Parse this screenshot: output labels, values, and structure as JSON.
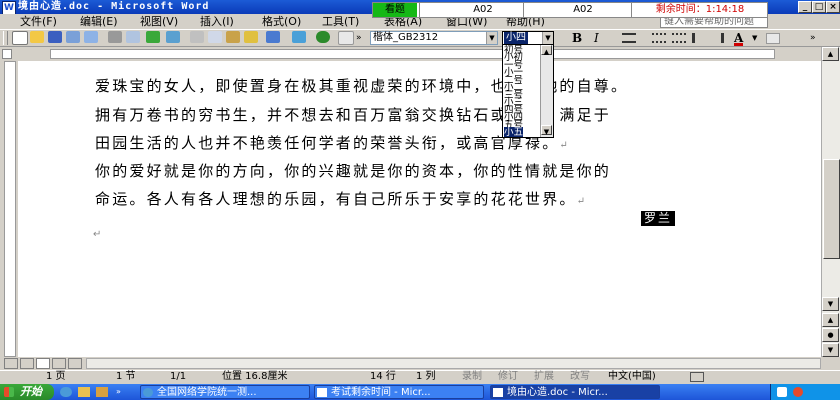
{
  "window": {
    "title": "境由心造.doc - Microsoft Word",
    "minimize_glyph": "_",
    "maximize_glyph": "□",
    "close_glyph": "×"
  },
  "exam_bar": {
    "status_label": "看题",
    "question_1": "A02",
    "question_2": "A02",
    "timer_label": "剩余时间：1:14:18"
  },
  "menu": {
    "items": [
      "文件(F)",
      "编辑(E)",
      "视图(V)",
      "插入(I)",
      "格式(O)",
      "工具(T)",
      "表格(A)",
      "窗口(W)",
      "帮助(H)"
    ],
    "help_box_text": "键入需要帮助的问题"
  },
  "formatting_toolbar": {
    "font_name": "楷体_GB2312",
    "font_size": "小四",
    "bold_label": "B",
    "italic_label": "I",
    "font_color_label": "A"
  },
  "size_dropdown": {
    "options": [
      "初号",
      "小初",
      "一号",
      "小一",
      "二号",
      "小二",
      "三号",
      "小三",
      "四号",
      "小四",
      "五号",
      "小五"
    ],
    "selected_index": 9
  },
  "document": {
    "lines": [
      "爱珠宝的女人，即使置身在极其重视虚荣的环境中，也不伤她的自尊。",
      "拥有万卷书的穷书生，并不想去和百万富翁交换钻石或股票。满足于",
      "田园生活的人也并不艳羡任何学者的荣誉头衔，或高官厚禄。",
      "你的爱好就是你的方向，你的兴趣就是你的资本，你的性情就是你的",
      "命运。各人有各人理想的乐园，有自己所乐于安享的花花世界。"
    ],
    "paragraph_mark": "↵",
    "author": "罗兰"
  },
  "status_bar": {
    "page": "1 页",
    "section": "1 节",
    "page_count": "1/1",
    "position": "位置 16.8厘米",
    "line": "14 行",
    "column": "1 列",
    "rec": "录制",
    "trk": "修订",
    "ext": "扩展",
    "ovr": "改写",
    "language": "中文(中国)"
  },
  "taskbar": {
    "start_label": "开始",
    "tasks": [
      {
        "label": "全国网络学院统一测...",
        "active": false
      },
      {
        "label": "考试剩余时间 - Micr...",
        "active": false
      },
      {
        "label": "境由心造.doc - Micr...",
        "active": true
      }
    ]
  },
  "colors": {
    "titlebar": "#0a3ab8",
    "selection": "#0a246a",
    "exam_status": "#16b816",
    "timer": "#d00000"
  }
}
